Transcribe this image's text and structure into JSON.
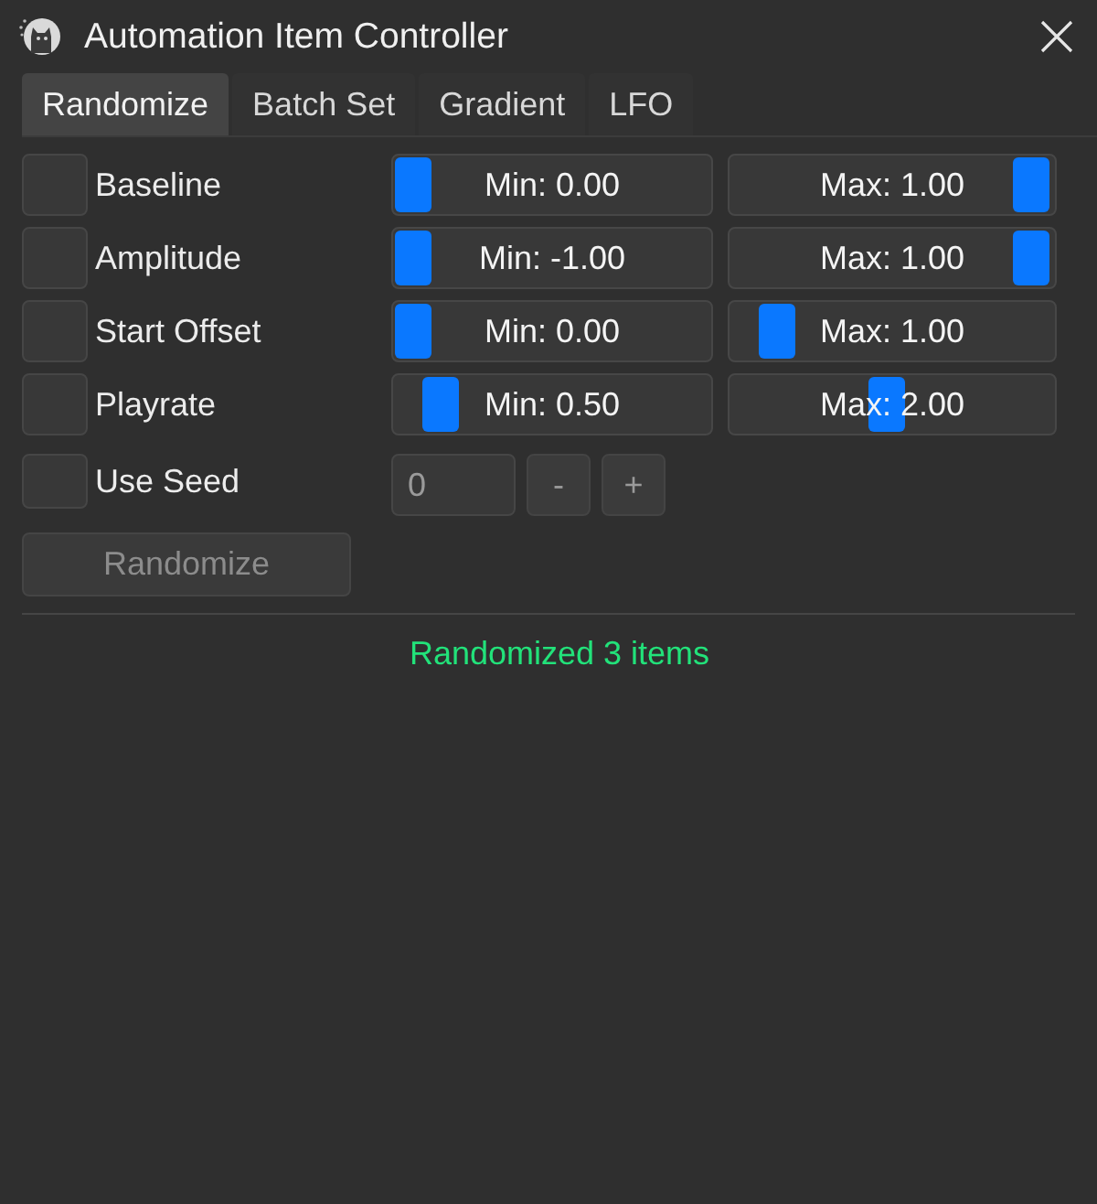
{
  "window": {
    "title": "Automation Item Controller"
  },
  "tabs": [
    {
      "label": "Randomize",
      "selected": true
    },
    {
      "label": "Batch Set",
      "selected": false
    },
    {
      "label": "Gradient",
      "selected": false
    },
    {
      "label": "LFO",
      "selected": false
    }
  ],
  "params": [
    {
      "name": "Baseline",
      "checked": false,
      "min": {
        "text": "Min: 0.00",
        "level": 0
      },
      "max": {
        "text": "Max: 1.00",
        "level": 1
      }
    },
    {
      "name": "Amplitude",
      "checked": false,
      "min": {
        "text": "Min: -1.00",
        "level": 0
      },
      "max": {
        "text": "Max: 1.00",
        "level": 1
      }
    },
    {
      "name": "Start Offset",
      "checked": false,
      "min": {
        "text": "Min: 0.00",
        "level": 0
      },
      "max": {
        "text": "Max: 1.00",
        "level": 0.1
      }
    },
    {
      "name": "Playrate",
      "checked": false,
      "min": {
        "text": "Min: 0.50",
        "level": 0.1
      },
      "max": {
        "text": "Max: 2.00",
        "level": 0.49
      }
    }
  ],
  "seed": {
    "label": "Use Seed",
    "checked": false,
    "value": "0",
    "disabled": true,
    "decrement": "-",
    "increment": "+"
  },
  "randomize_button": {
    "label": "Randomize",
    "disabled": true
  },
  "status": {
    "text": "Randomized 3 items"
  }
}
